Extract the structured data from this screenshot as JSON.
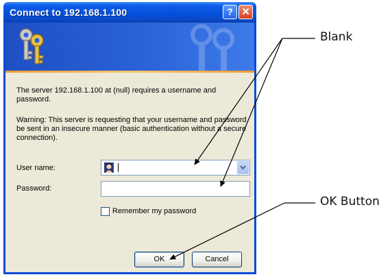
{
  "window": {
    "title": "Connect to 192.168.1.100",
    "help_glyph": "?",
    "close_glyph": "✕"
  },
  "banner": {
    "icon": "keys-icon",
    "watermark_icon": "keys-watermark-icon"
  },
  "message": {
    "line1": "The server 192.168.1.100 at (null) requires a username and password.",
    "warning": "Warning: This server is requesting that your username and password be sent in an insecure manner (basic authentication without a secure connection)."
  },
  "form": {
    "username_label": "User name:",
    "username_value": "",
    "password_label": "Password:",
    "password_value": "",
    "remember_label": "Remember my password",
    "remember_checked": false,
    "user_icon": "user-icon",
    "dropdown_icon": "chevron-down-icon"
  },
  "buttons": {
    "ok_label": "OK",
    "cancel_label": "Cancel"
  },
  "annotations": {
    "blank_label": "Blank",
    "ok_button_label": "OK Button"
  },
  "colors": {
    "titlebar": "#0651dc",
    "client_bg": "#ece9d8",
    "banner": "#2a62d8",
    "banner_stripe": "#ec9a34",
    "input_border": "#7f9db9"
  }
}
